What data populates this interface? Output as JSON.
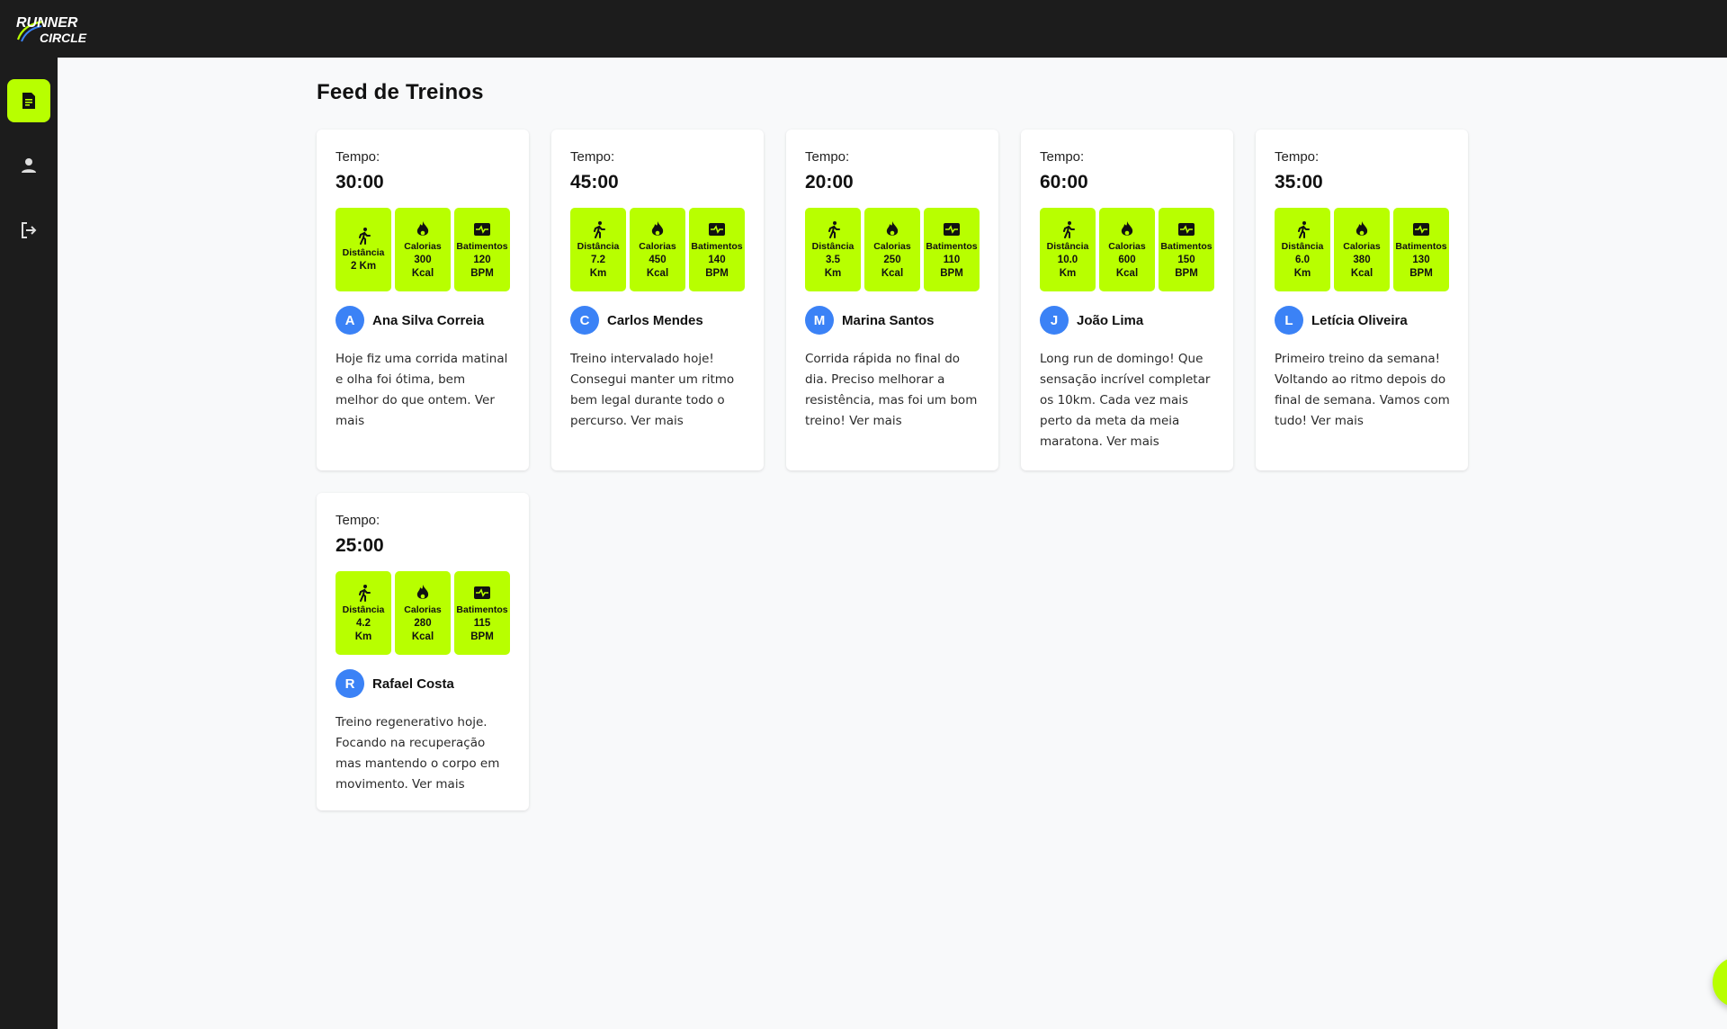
{
  "app": {
    "logo_top": "RUNNER",
    "logo_bottom": "CIRCLE",
    "accent_color": "#b8ff00",
    "avatar_color": "#3b82f6"
  },
  "sidebar": {
    "items": [
      {
        "name": "feed",
        "icon": "document-icon",
        "active": true
      },
      {
        "name": "profile",
        "icon": "person-icon",
        "active": false
      },
      {
        "name": "logout",
        "icon": "logout-icon",
        "active": false
      }
    ]
  },
  "page": {
    "title": "Feed de Treinos"
  },
  "labels": {
    "time": "Tempo:",
    "distance": "Distância",
    "calories": "Calorias",
    "heartbeat": "Batimentos"
  },
  "posts": [
    {
      "time": "30:00",
      "distance": "2 Km",
      "calories_val": "300",
      "calories_unit": "Kcal",
      "bpm_val": "120",
      "bpm_unit": "BPM",
      "initial": "A",
      "name": "Ana Silva Correia",
      "description": "Hoje fiz uma corrida matinal e olha foi ótima, bem melhor do que ontem. Ver mais"
    },
    {
      "time": "45:00",
      "distance_val": "7.2",
      "distance_unit": "Km",
      "calories_val": "450",
      "calories_unit": "Kcal",
      "bpm_val": "140",
      "bpm_unit": "BPM",
      "initial": "C",
      "name": "Carlos Mendes",
      "description": "Treino intervalado hoje! Consegui manter um ritmo bem legal durante todo o percurso. Ver mais"
    },
    {
      "time": "20:00",
      "distance_val": "3.5",
      "distance_unit": "Km",
      "calories_val": "250",
      "calories_unit": "Kcal",
      "bpm_val": "110",
      "bpm_unit": "BPM",
      "initial": "M",
      "name": "Marina Santos",
      "description": "Corrida rápida no final do dia. Preciso melhorar a resistência, mas foi um bom treino! Ver mais"
    },
    {
      "time": "60:00",
      "distance_val": "10.0",
      "distance_unit": "Km",
      "calories_val": "600",
      "calories_unit": "Kcal",
      "bpm_val": "150",
      "bpm_unit": "BPM",
      "initial": "J",
      "name": "João Lima",
      "description": "Long run de domingo! Que sensação incrível completar os 10km. Cada vez mais perto da meta da meia maratona. Ver mais"
    },
    {
      "time": "35:00",
      "distance_val": "6.0",
      "distance_unit": "Km",
      "calories_val": "380",
      "calories_unit": "Kcal",
      "bpm_val": "130",
      "bpm_unit": "BPM",
      "initial": "L",
      "name": "Letícia Oliveira",
      "description": "Primeiro treino da semana! Voltando ao ritmo depois do final de semana. Vamos com tudo! Ver mais"
    },
    {
      "time": "25:00",
      "distance_val": "4.2",
      "distance_unit": "Km",
      "calories_val": "280",
      "calories_unit": "Kcal",
      "bpm_val": "115",
      "bpm_unit": "BPM",
      "initial": "R",
      "name": "Rafael Costa",
      "description": "Treino regenerativo hoje. Focando na recuperação mas mantendo o corpo em movimento. Ver mais"
    }
  ],
  "fab": {
    "icon": "plus-icon"
  }
}
